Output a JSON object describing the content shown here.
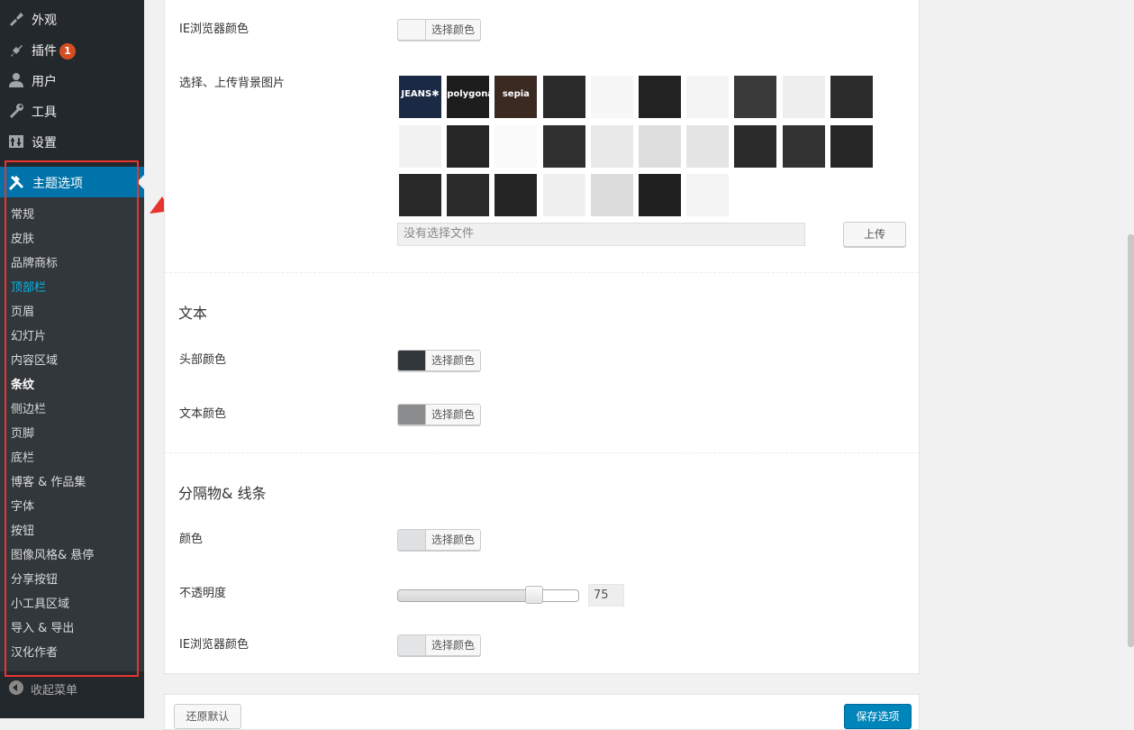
{
  "sidebar": {
    "menu": [
      {
        "label": "外观",
        "icon": "paintbrush-icon"
      },
      {
        "label": "插件",
        "icon": "plugin-icon",
        "badge": "1"
      },
      {
        "label": "用户",
        "icon": "user-icon"
      },
      {
        "label": "工具",
        "icon": "wrench-icon"
      },
      {
        "label": "设置",
        "icon": "settings-icon"
      }
    ],
    "current": {
      "label": "主题选项",
      "icon": "tools-icon"
    },
    "submenu": [
      "常规",
      "皮肤",
      "品牌商标",
      "顶部栏",
      "页眉",
      "幻灯片",
      "内容区域",
      "条纹",
      "侧边栏",
      "页脚",
      "底栏",
      "博客 & 作品集",
      "字体",
      "按钮",
      "图像风格& 悬停",
      "分享按钮",
      "小工具区域",
      "导入 & 导出",
      "汉化作者"
    ],
    "active_submenu": "顶部栏",
    "bold_submenu": "条纹",
    "collapse_label": "收起菜单"
  },
  "panel": {
    "ie_color_label_top": "IE浏览器颜色",
    "choose_color": "选择颜色",
    "bg_image_label": "选择、上传背景图片",
    "patterns": [
      {
        "text": "JEANS✱",
        "bg": "#1b2a44"
      },
      {
        "text": "polygonal",
        "bg": "#1d1d1d"
      },
      {
        "text": "sepia",
        "bg": "#3a2a22"
      },
      {
        "text": "",
        "bg": "#2a2a2a"
      },
      {
        "text": "",
        "bg": "#f7f7f7"
      },
      {
        "text": "",
        "bg": "#222222"
      },
      {
        "text": "",
        "bg": "#f4f4f4"
      },
      {
        "text": "",
        "bg": "#3a3a3a"
      },
      {
        "text": "",
        "bg": "#eeeeee"
      },
      {
        "text": "",
        "bg": "#2c2c2c"
      },
      {
        "text": "",
        "bg": "#f2f2f2"
      },
      {
        "text": "",
        "bg": "#262626"
      },
      {
        "text": "",
        "bg": "#fafafa"
      },
      {
        "text": "",
        "bg": "#303030"
      },
      {
        "text": "",
        "bg": "#e9e9e9"
      },
      {
        "text": "",
        "bg": "#dedede"
      },
      {
        "text": "",
        "bg": "#e4e4e4"
      },
      {
        "text": "",
        "bg": "#2a2a2a"
      },
      {
        "text": "",
        "bg": "#333333"
      },
      {
        "text": "",
        "bg": "#262626"
      },
      {
        "text": "",
        "bg": "#292929"
      },
      {
        "text": "",
        "bg": "#2b2b2b"
      },
      {
        "text": "",
        "bg": "#252525"
      },
      {
        "text": "",
        "bg": "#f0f0f0"
      },
      {
        "text": "",
        "bg": "#dcdcdc"
      },
      {
        "text": "",
        "bg": "#1f1f1f"
      },
      {
        "text": "",
        "bg": "#f3f3f3"
      }
    ],
    "file_placeholder": "没有选择文件",
    "upload_label": "上传",
    "text_section_title": "文本",
    "heading_color_label": "头部颜色",
    "heading_color": "#32373c",
    "text_color_label": "文本颜色",
    "text_color": "#8a8c8e",
    "divider_section_title": "分隔物& 线条",
    "color_label": "颜色",
    "line_color": "#dfe1e3",
    "opacity_label": "不透明度",
    "opacity_value": "75",
    "opacity_max": 100,
    "ie_color_label_bottom": "IE浏览器颜色",
    "ie_color": "#e3e5e7",
    "ie_color_top": "#f7f7f7"
  },
  "footer": {
    "reset_label": "还原默认",
    "save_label": "保存选项"
  },
  "colors": {
    "sidebar_bg": "#23282d",
    "submenu_bg": "#32373c",
    "accent": "#0073aa",
    "active_link": "#00b9eb",
    "highlight_red": "#e8342f"
  }
}
